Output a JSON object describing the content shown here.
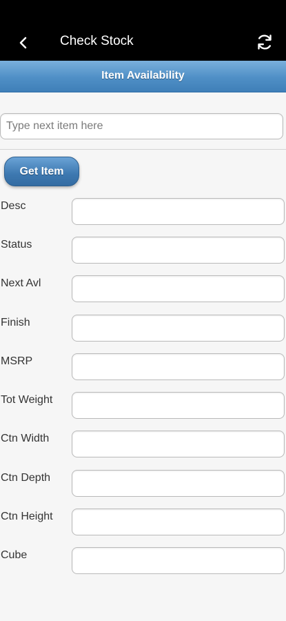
{
  "app_bar": {
    "title": "Check Stock",
    "back_icon": "chevron-left-icon",
    "refresh_icon": "refresh-icon"
  },
  "section_header": {
    "title": "Item Availability"
  },
  "search": {
    "placeholder": "Type next item here",
    "value": ""
  },
  "get_item_button": {
    "label": "Get Item"
  },
  "fields": [
    {
      "label": "Desc",
      "value": ""
    },
    {
      "label": "Status",
      "value": ""
    },
    {
      "label": "Next Avl",
      "value": ""
    },
    {
      "label": "Finish",
      "value": ""
    },
    {
      "label": "MSRP",
      "value": ""
    },
    {
      "label": "Tot Weight",
      "value": ""
    },
    {
      "label": "Ctn Width",
      "value": ""
    },
    {
      "label": "Ctn Depth",
      "value": ""
    },
    {
      "label": "Ctn Height",
      "value": ""
    },
    {
      "label": "Cube",
      "value": ""
    }
  ],
  "colors": {
    "app_bar_bg": "#000000",
    "header_blue": "#4f8fc6",
    "button_blue": "#3d78b0",
    "page_bg": "#f6f6f6"
  }
}
